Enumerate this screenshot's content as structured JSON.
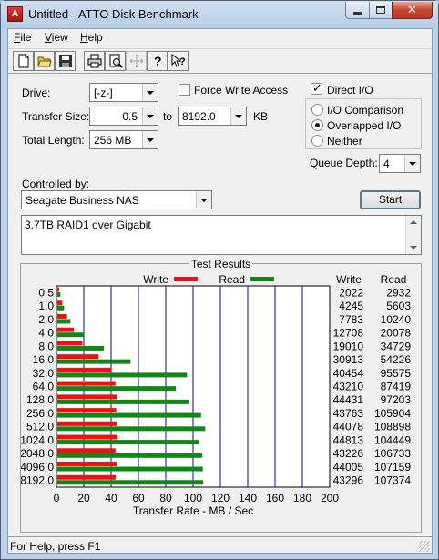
{
  "window": {
    "title": "Untitled - ATTO Disk Benchmark",
    "app_icon_letter": "A"
  },
  "menu": [
    {
      "label": "File",
      "accel": "F",
      "rest": "ile"
    },
    {
      "label": "View",
      "accel": "V",
      "rest": "iew"
    },
    {
      "label": "Help",
      "accel": "H",
      "rest": "elp"
    }
  ],
  "toolbar": [
    "new-icon",
    "open-icon",
    "save-icon",
    "print-icon",
    "print-preview-icon",
    "move-icon",
    "help-icon",
    "context-help-icon"
  ],
  "settings": {
    "drive_label": "Drive:",
    "drive_value": "[-z-]",
    "force_write_label": "Force Write Access",
    "force_write_checked": false,
    "direct_io_label": "Direct I/O",
    "direct_io_checked": true,
    "transfer_size_label": "Transfer Size:",
    "transfer_from": "0.5",
    "transfer_to_label": "to",
    "transfer_to": "8192.0",
    "transfer_unit": "KB",
    "total_length_label": "Total Length:",
    "total_length": "256 MB",
    "io_options": [
      "I/O Comparison",
      "Overlapped I/O",
      "Neither"
    ],
    "io_selected": "Overlapped I/O",
    "queue_depth_label": "Queue Depth:",
    "queue_depth": "4",
    "controlled_by_label": "Controlled by:",
    "controlled_by": "Seagate Business NAS",
    "start_label": "Start",
    "description": "3.7TB RAID1 over Gigabit"
  },
  "chart_data": {
    "type": "bar",
    "title": "Test Results",
    "orientation": "horizontal",
    "categories": [
      "0.5",
      "1.0",
      "2.0",
      "4.0",
      "8.0",
      "16.0",
      "32.0",
      "64.0",
      "128.0",
      "256.0",
      "512.0",
      "1024.0",
      "2048.0",
      "4096.0",
      "8192.0"
    ],
    "series": [
      {
        "name": "Write",
        "color": "#ee1111",
        "values": [
          2022,
          4245,
          7783,
          12708,
          19010,
          30913,
          40454,
          43210,
          44431,
          43763,
          44078,
          44813,
          43226,
          44005,
          43296
        ]
      },
      {
        "name": "Read",
        "color": "#118811",
        "values": [
          2932,
          5603,
          10240,
          20078,
          34729,
          54226,
          95575,
          87419,
          97203,
          105904,
          108898,
          104449,
          106733,
          107159,
          107374
        ]
      }
    ],
    "xlabel": "Transfer Rate - MB / Sec",
    "xlim": [
      0,
      200
    ],
    "xticks": [
      0,
      20,
      40,
      60,
      80,
      100,
      120,
      140,
      160,
      180,
      200
    ],
    "value_unit": "KB/s",
    "value_columns": [
      "Write",
      "Read"
    ],
    "grid": true
  },
  "status": {
    "text": "For Help, press F1"
  }
}
